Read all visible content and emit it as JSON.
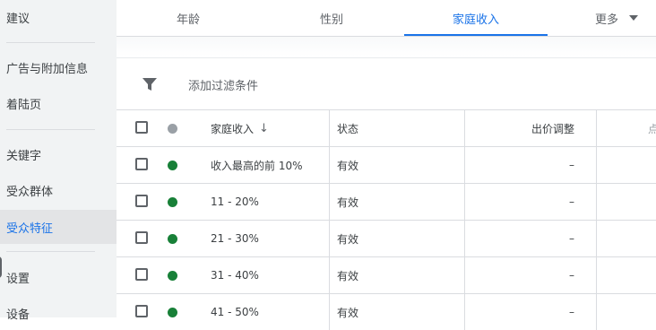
{
  "sidebar": {
    "items": [
      {
        "label": "建议"
      },
      {
        "label": "广告与附加信息"
      },
      {
        "label": "着陆页"
      },
      {
        "label": "关键字"
      },
      {
        "label": "受众群体"
      },
      {
        "label": "受众特征"
      },
      {
        "label": "设置"
      },
      {
        "label": "设备"
      }
    ]
  },
  "tabs": {
    "items": [
      {
        "label": "年龄"
      },
      {
        "label": "性别"
      },
      {
        "label": "家庭收入"
      }
    ],
    "more_label": "更多"
  },
  "filter": {
    "label": "添加过滤条件"
  },
  "table": {
    "headers": {
      "income": "家庭收入",
      "status": "状态",
      "bid": "出价调整",
      "partial": "点"
    },
    "rows": [
      {
        "income": "收入最高的前 10%",
        "status": "有效",
        "bid": "–"
      },
      {
        "income": "11 - 20%",
        "status": "有效",
        "bid": "–"
      },
      {
        "income": "21 - 30%",
        "status": "有效",
        "bid": "–"
      },
      {
        "income": "31 - 40%",
        "status": "有效",
        "bid": "–"
      },
      {
        "income": "41 - 50%",
        "status": "有效",
        "bid": "–"
      }
    ]
  },
  "colors": {
    "accent": "#1a73e8",
    "status_active": "#188038",
    "status_header": "#9aa0a6"
  },
  "icons": {
    "filter": "filter-icon",
    "sort": "arrow-down-icon",
    "more": "caret-down-icon"
  }
}
